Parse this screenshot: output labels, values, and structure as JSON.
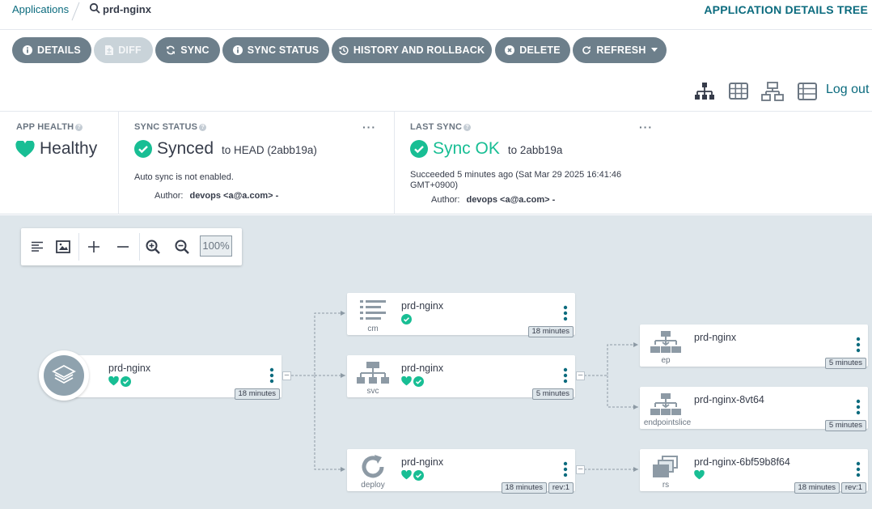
{
  "breadcrumb": {
    "link": "Applications",
    "current": "prd-nginx"
  },
  "page_view_title": "APPLICATION DETAILS TREE",
  "toolbar": {
    "details": "DETAILS",
    "diff": "DIFF",
    "sync": "SYNC",
    "sync_status": "SYNC STATUS",
    "history": "HISTORY AND ROLLBACK",
    "delete": "DELETE",
    "refresh": "REFRESH"
  },
  "logout": "Log out",
  "status": {
    "app_health": {
      "label": "APP HEALTH",
      "value": "Healthy"
    },
    "sync_status": {
      "label": "SYNC STATUS",
      "value": "Synced",
      "target": "to HEAD (2abb19a)",
      "auto_sync": "Auto sync is not enabled.",
      "author_label": "Author:",
      "author": "devops <a@a.com> -"
    },
    "last_sync": {
      "label": "LAST SYNC",
      "value": "Sync OK",
      "target": "to 2abb19a",
      "detail_line1": "Succeeded 5 minutes ago (Sat Mar 29 2025 16:41:46",
      "detail_line2": "GMT+0900)",
      "author_label": "Author:",
      "author": "devops <a@a.com> -"
    },
    "dots": "···"
  },
  "graph_controls": {
    "zoom": "100%"
  },
  "app_node": {
    "name": "prd-nginx",
    "age": "18 minutes"
  },
  "nodes": {
    "cm": {
      "name": "prd-nginx",
      "kind": "cm",
      "age": "18 minutes"
    },
    "svc": {
      "name": "prd-nginx",
      "kind": "svc",
      "age": "5 minutes"
    },
    "deploy": {
      "name": "prd-nginx",
      "kind": "deploy",
      "age": "18 minutes",
      "rev": "rev:1"
    },
    "ep": {
      "name": "prd-nginx",
      "kind": "ep",
      "age": "5 minutes"
    },
    "endpointslice": {
      "name": "prd-nginx-8vt64",
      "kind": "endpointslice",
      "age": "5 minutes"
    },
    "rs": {
      "name": "prd-nginx-6bf59b8f64",
      "kind": "rs",
      "age": "18 minutes",
      "rev": "rev:1"
    }
  },
  "colors": {
    "accent": "#0b6b7e",
    "healthy": "#18be94",
    "button": "#6d7f8b",
    "canvas": "#dee6eb"
  }
}
